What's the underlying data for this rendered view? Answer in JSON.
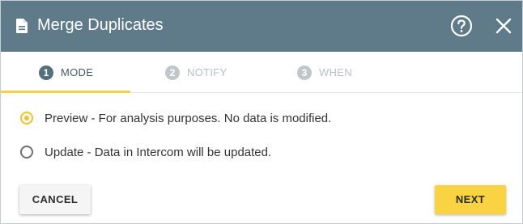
{
  "dialog": {
    "title": "Merge Duplicates",
    "title_icon": "document-icon",
    "help_icon": "help-circle-icon",
    "close_icon": "close-icon"
  },
  "steps": [
    {
      "number": "1",
      "label": "MODE",
      "active": true
    },
    {
      "number": "2",
      "label": "NOTIFY",
      "active": false
    },
    {
      "number": "3",
      "label": "WHEN",
      "active": false
    }
  ],
  "options": [
    {
      "label": "Preview - For analysis purposes. No data is modified.",
      "selected": true
    },
    {
      "label": "Update - Data in Intercom will be updated.",
      "selected": false
    }
  ],
  "buttons": {
    "cancel": "CANCEL",
    "next": "NEXT"
  },
  "colors": {
    "header_bg": "#5f7b89",
    "accent_yellow": "#f9d342",
    "active_step": "#546e7a",
    "inactive_step": "#c0c7cb"
  }
}
